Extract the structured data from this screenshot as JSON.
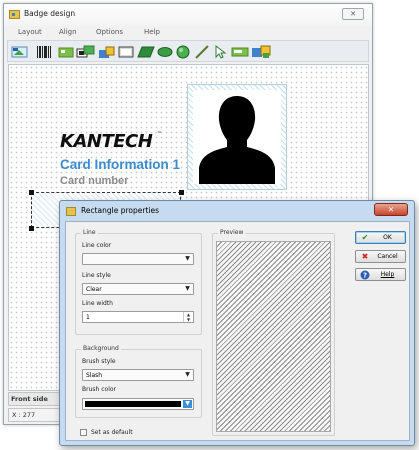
{
  "window": {
    "title": "Badge design",
    "close_glyph": "✕",
    "menu": [
      "Layout",
      "Align",
      "Options",
      "Help"
    ]
  },
  "toolbar": {
    "tools": [
      "select-image-tool",
      "barcode-tool",
      "image-tool",
      "picture-tool",
      "text-tool",
      "rectangle-tool",
      "rounded-rect-tool",
      "ellipse-tool",
      "circle-tool",
      "line-tool",
      "pointer-tool",
      "textbox-tool",
      "card-field-tool"
    ]
  },
  "badge": {
    "logo": "KANTECH",
    "logo_tm": "™",
    "card_info": "Card Information 1",
    "card_number": "Card number"
  },
  "bottom": {
    "tab": "Front side",
    "cursor_x": "X : 277"
  },
  "dialog": {
    "title": "Rectangle properties",
    "close_glyph": "✕",
    "line_group": "Line",
    "line_color_label": "Line color",
    "line_color_value": "",
    "line_style_label": "Line style",
    "line_style_value": "Clear",
    "line_width_label": "Line width",
    "line_width_value": "1",
    "background_group": "Background",
    "brush_style_label": "Brush style",
    "brush_style_value": "Slash",
    "brush_color_label": "Brush color",
    "brush_color_value": "#000000",
    "preview_group": "Preview",
    "set_default_label": "Set as default",
    "set_default_checked": false,
    "buttons": {
      "ok": "OK",
      "cancel": "Cancel",
      "help": "Help"
    }
  },
  "colors": {
    "accent_blue": "#3b8bd1",
    "dialog_frame": "#c6dbef",
    "close_red": "#c7452c"
  }
}
